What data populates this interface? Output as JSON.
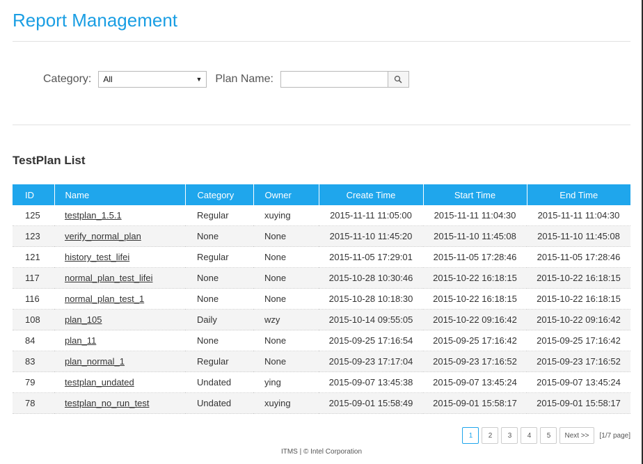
{
  "header": {
    "title": "Report Management"
  },
  "filters": {
    "category_label": "Category:",
    "category_value": "All",
    "plan_name_label": "Plan Name:",
    "plan_name_value": ""
  },
  "section": {
    "title": "TestPlan List"
  },
  "table": {
    "columns": [
      "ID",
      "Name",
      "Category",
      "Owner",
      "Create Time",
      "Start Time",
      "End Time"
    ],
    "rows": [
      {
        "id": "125",
        "name": "testplan_1.5.1",
        "category": "Regular",
        "owner": "xuying",
        "create": "2015-11-11 11:05:00",
        "start": "2015-11-11 11:04:30",
        "end": "2015-11-11 11:04:30"
      },
      {
        "id": "123",
        "name": "verify_normal_plan",
        "category": "None",
        "owner": "None",
        "create": "2015-11-10 11:45:20",
        "start": "2015-11-10 11:45:08",
        "end": "2015-11-10 11:45:08"
      },
      {
        "id": "121",
        "name": "history_test_lifei",
        "category": "Regular",
        "owner": "None",
        "create": "2015-11-05 17:29:01",
        "start": "2015-11-05 17:28:46",
        "end": "2015-11-05 17:28:46"
      },
      {
        "id": "117",
        "name": "normal_plan_test_lifei",
        "category": "None",
        "owner": "None",
        "create": "2015-10-28 10:30:46",
        "start": "2015-10-22 16:18:15",
        "end": "2015-10-22 16:18:15"
      },
      {
        "id": "116",
        "name": "normal_plan_test_1",
        "category": "None",
        "owner": "None",
        "create": "2015-10-28 10:18:30",
        "start": "2015-10-22 16:18:15",
        "end": "2015-10-22 16:18:15"
      },
      {
        "id": "108",
        "name": "plan_105",
        "category": "Daily",
        "owner": "wzy",
        "create": "2015-10-14 09:55:05",
        "start": "2015-10-22 09:16:42",
        "end": "2015-10-22 09:16:42"
      },
      {
        "id": "84",
        "name": "plan_11",
        "category": "None",
        "owner": "None",
        "create": "2015-09-25 17:16:54",
        "start": "2015-09-25 17:16:42",
        "end": "2015-09-25 17:16:42"
      },
      {
        "id": "83",
        "name": "plan_normal_1",
        "category": "Regular",
        "owner": "None",
        "create": "2015-09-23 17:17:04",
        "start": "2015-09-23 17:16:52",
        "end": "2015-09-23 17:16:52"
      },
      {
        "id": "79",
        "name": "testplan_undated",
        "category": "Undated",
        "owner": "ying",
        "create": "2015-09-07 13:45:38",
        "start": "2015-09-07 13:45:24",
        "end": "2015-09-07 13:45:24"
      },
      {
        "id": "78",
        "name": "testplan_no_run_test",
        "category": "Undated",
        "owner": "xuying",
        "create": "2015-09-01 15:58:49",
        "start": "2015-09-01 15:58:17",
        "end": "2015-09-01 15:58:17"
      }
    ]
  },
  "pagination": {
    "pages": [
      "1",
      "2",
      "3",
      "4",
      "5"
    ],
    "active_page": "1",
    "next_label": "Next >>",
    "info": "[1/7 page]"
  },
  "footer": {
    "text": "ITMS | © Intel Corporation"
  },
  "icons": {
    "search": "search-icon",
    "dropdown": "chevron-down-icon"
  },
  "colors": {
    "accent": "#1fa6ec",
    "title": "#1a9ee3"
  }
}
